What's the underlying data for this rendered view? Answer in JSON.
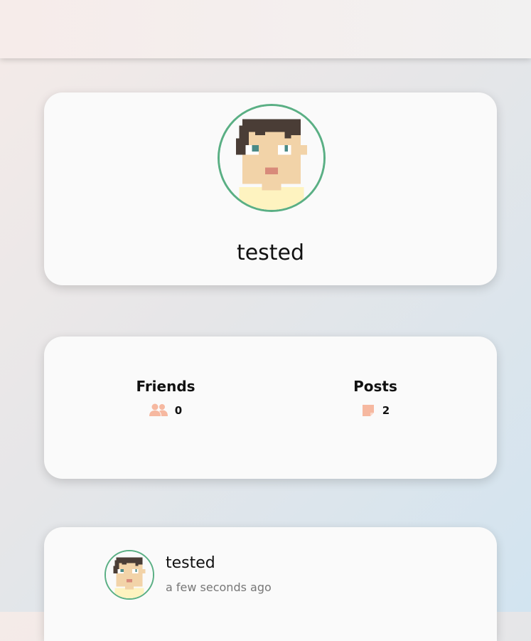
{
  "profile": {
    "username": "tested"
  },
  "stats": {
    "friends": {
      "label": "Friends",
      "value": "0",
      "icon": "users-icon"
    },
    "posts": {
      "label": "Posts",
      "value": "2",
      "icon": "note-icon"
    }
  },
  "post": {
    "author": "tested",
    "time": "a few seconds ago"
  },
  "colors": {
    "avatar_ring": "#5aaf84",
    "stat_icon": "#f6b8a0",
    "card_bg": "#fafafa"
  }
}
